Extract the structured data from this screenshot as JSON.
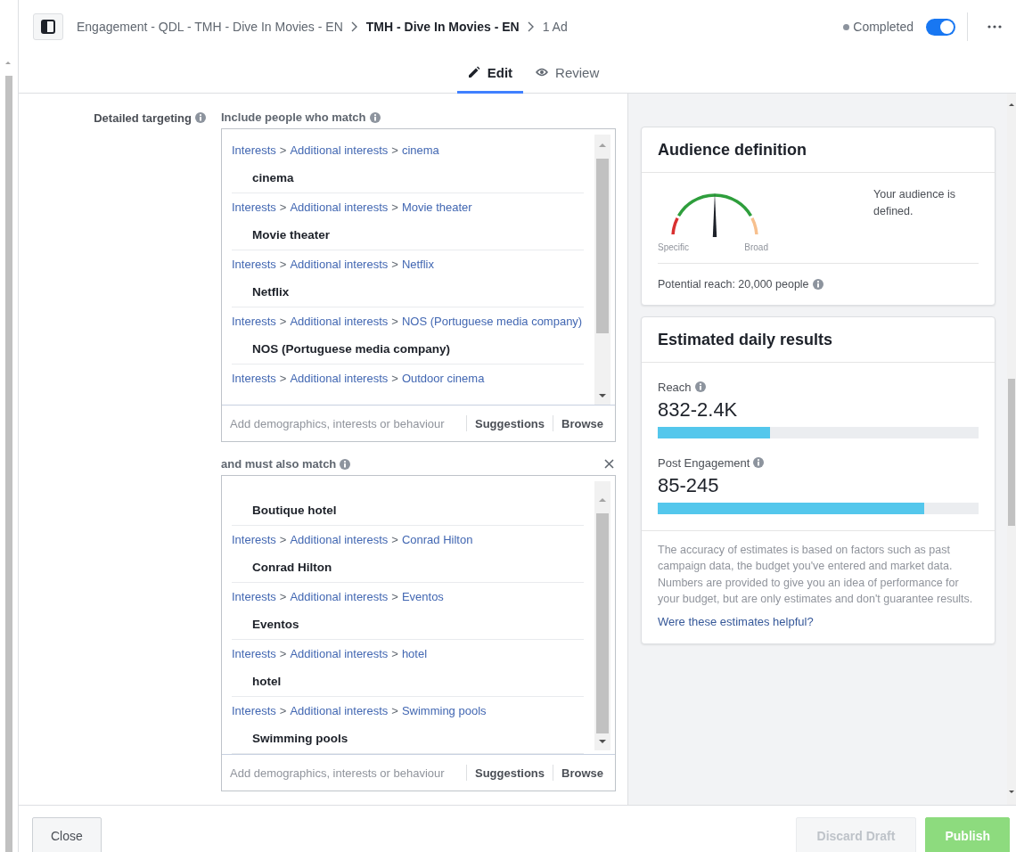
{
  "header": {
    "breadcrumbs": [
      {
        "label": "Engagement - QDL - TMH - Dive In Movies - EN",
        "current": false
      },
      {
        "label": "TMH - Dive In Movies - EN",
        "current": true
      },
      {
        "label": "1 Ad",
        "current": false
      }
    ],
    "status": {
      "label": "Completed",
      "color": "#8d949e"
    },
    "toggle": {
      "on": true
    }
  },
  "tabs": [
    {
      "label": "Edit",
      "kind": "edit",
      "selected": true
    },
    {
      "label": "Review",
      "kind": "review",
      "selected": false
    }
  ],
  "targeting": {
    "label": "Detailed targeting",
    "path_separator": ">",
    "groups": [
      {
        "heading": "Include people who match",
        "removable": false,
        "items": [
          {
            "path": [
              "Interests",
              "Additional interests",
              "cinema"
            ],
            "name": "cinema"
          },
          {
            "path": [
              "Interests",
              "Additional interests",
              "Movie theater"
            ],
            "name": "Movie theater"
          },
          {
            "path": [
              "Interests",
              "Additional interests",
              "Netflix"
            ],
            "name": "Netflix"
          },
          {
            "path": [
              "Interests",
              "Additional interests",
              "NOS (Portuguese media company)"
            ],
            "name": "NOS (Portuguese media company)"
          },
          {
            "path": [
              "Interests",
              "Additional interests",
              "Outdoor cinema"
            ]
          }
        ],
        "placeholder": "Add demographics, interests or behaviour",
        "actions": [
          "Suggestions",
          "Browse"
        ]
      },
      {
        "heading": "and must also match",
        "removable": true,
        "items": [
          {
            "name": "Boutique hotel"
          },
          {
            "path": [
              "Interests",
              "Additional interests",
              "Conrad Hilton"
            ],
            "name": "Conrad Hilton"
          },
          {
            "path": [
              "Interests",
              "Additional interests",
              "Eventos"
            ],
            "name": "Eventos"
          },
          {
            "path": [
              "Interests",
              "Additional interests",
              "hotel"
            ],
            "name": "hotel"
          },
          {
            "path": [
              "Interests",
              "Additional interests",
              "Swimming pools"
            ],
            "name": "Swimming pools"
          }
        ],
        "placeholder": "Add demographics, interests or behaviour",
        "actions": [
          "Suggestions",
          "Browse"
        ]
      }
    ]
  },
  "audience": {
    "title": "Audience definition",
    "gauge": {
      "low_label": "Specific",
      "high_label": "Broad",
      "level": 0.5
    },
    "message": "Your audience is defined.",
    "potential_reach": "Potential reach: 20,000 people"
  },
  "results": {
    "title": "Estimated daily results",
    "metrics": [
      {
        "label": "Reach",
        "value": "832-2.4K",
        "level": 0.35
      },
      {
        "label": "Post Engagement",
        "value": "85-245",
        "level": 0.83
      }
    ],
    "disclaimer": "The accuracy of estimates is based on factors such as past campaign data, the budget you've entered and market data. Numbers are provided to give you an idea of performance for your budget, but are only estimates and don't guarantee results.",
    "link": "Were these estimates helpful?"
  },
  "footer": {
    "buttons": [
      {
        "label": "Close",
        "kind": "secondary",
        "disabled": false
      },
      {
        "label": "Discard Draft",
        "kind": "secondary",
        "disabled": true
      },
      {
        "label": "Publish",
        "kind": "primary",
        "disabled": true
      }
    ]
  }
}
